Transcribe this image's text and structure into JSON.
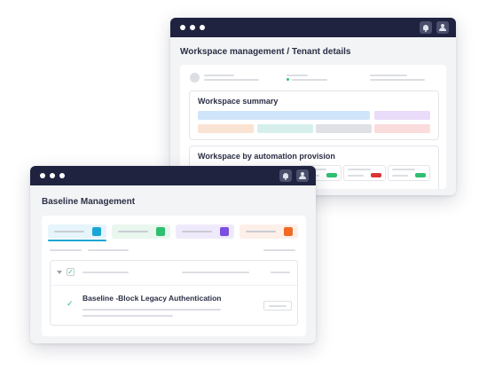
{
  "windows": {
    "tenant": {
      "title": "Workspace management / Tenant details",
      "cards": {
        "summary": {
          "title": "Workspace summary"
        },
        "automation": {
          "title": "Workspace by automation provision"
        }
      },
      "status_colors": [
        "#2fbf71",
        "#d93636",
        "#2fbf71"
      ]
    },
    "baseline": {
      "title": "Baseline Management",
      "tabs": [
        {
          "color": "#1aa6d4",
          "bg": "#e6f4fb"
        },
        {
          "color": "#2fbf71",
          "bg": "#e9f7ef"
        },
        {
          "color": "#7b4fe0",
          "bg": "#efeafb"
        },
        {
          "color": "#f06a25",
          "bg": "#fdf0e9"
        }
      ],
      "item": {
        "title": "Baseline -Block Legacy Authentication"
      }
    }
  },
  "icons": [
    "bell-icon",
    "user-icon",
    "check-icon",
    "chevron-down-icon"
  ]
}
